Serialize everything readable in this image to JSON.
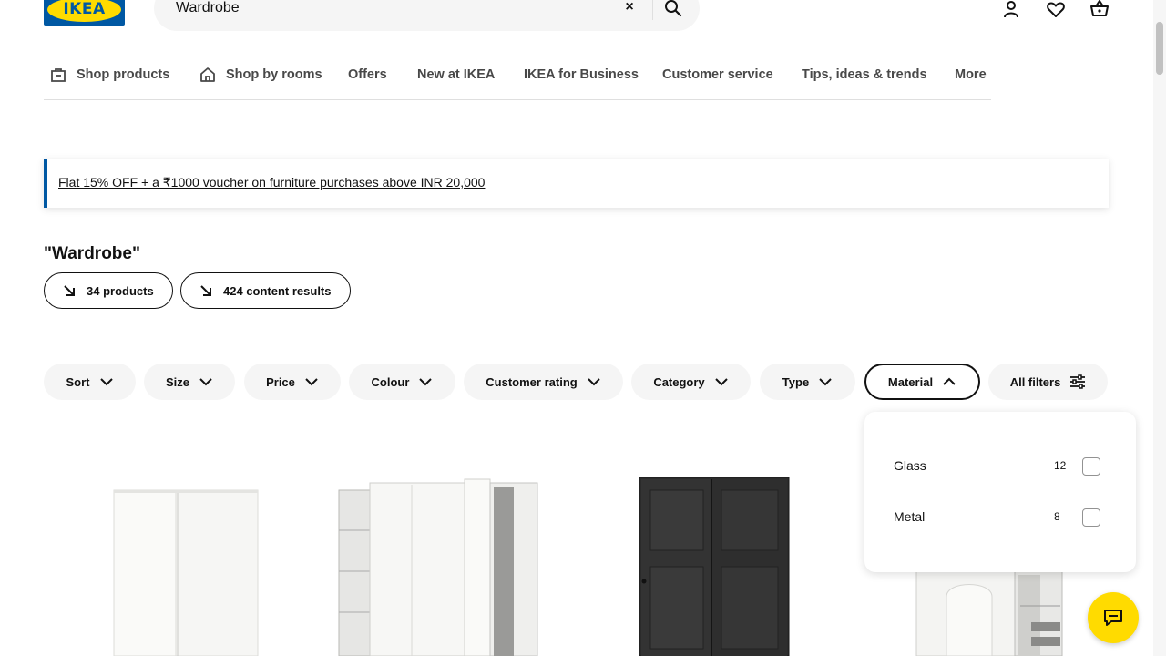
{
  "header": {
    "logo_text": "IKEA",
    "search": {
      "value": "Wardrobe",
      "clear_symbol": "×"
    },
    "icons": [
      "user-icon",
      "heart-icon",
      "basket-icon"
    ]
  },
  "nav": {
    "items": [
      {
        "label": "Shop products",
        "icon": "store-bag-icon"
      },
      {
        "label": "Shop by rooms",
        "icon": "house-icon"
      },
      {
        "label": "Offers"
      },
      {
        "label": "New at IKEA"
      },
      {
        "label": "IKEA for Business"
      },
      {
        "label": "Customer service"
      },
      {
        "label": "Tips, ideas & trends"
      },
      {
        "label": "More"
      }
    ]
  },
  "banner": {
    "text": "Flat 15% OFF + a ₹1000 voucher on furniture purchases above INR 20,000",
    "accent": "#0058a3"
  },
  "results": {
    "title": "\"Wardrobe\"",
    "products_pill": "34 products",
    "content_pill": "424 content results"
  },
  "filters": {
    "items": [
      "Sort",
      "Size",
      "Price",
      "Colour",
      "Customer rating",
      "Category",
      "Type",
      "Material",
      "All filters"
    ],
    "active": "Material"
  },
  "material_dropdown": {
    "options": [
      {
        "label": "Glass",
        "count": "12",
        "checked": false
      },
      {
        "label": "Metal",
        "count": "8",
        "checked": false
      }
    ]
  },
  "products": [
    {
      "image": "white-sliding-wardrobe"
    },
    {
      "image": "white-wardrobe-open-shelves"
    },
    {
      "image": "black-brown-sliding-wardrobe"
    },
    {
      "image": "white-wardrobe-open-drawers"
    }
  ],
  "chat": {
    "icon": "chat-icon",
    "color": "#ffdb00"
  }
}
